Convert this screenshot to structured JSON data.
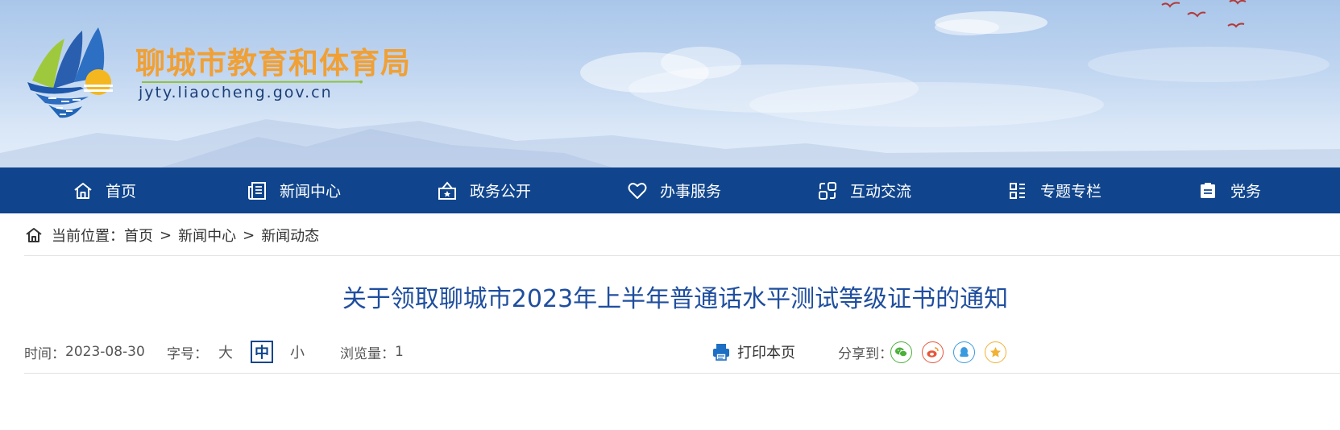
{
  "header": {
    "site_name": "聊城市教育和体育局",
    "site_domain": "jyty.liaocheng.gov.cn",
    "brand_orange": "#f0a035",
    "brand_blue": "#10458d"
  },
  "nav": {
    "items": [
      {
        "label": "首页",
        "icon": "home-icon"
      },
      {
        "label": "新闻中心",
        "icon": "newspaper-icon"
      },
      {
        "label": "政务公开",
        "icon": "government-icon"
      },
      {
        "label": "办事服务",
        "icon": "heart-icon"
      },
      {
        "label": "互动交流",
        "icon": "interaction-icon"
      },
      {
        "label": "专题专栏",
        "icon": "grid-icon"
      },
      {
        "label": "党务",
        "icon": "party-icon"
      }
    ]
  },
  "breadcrumb": {
    "prefix": "当前位置：",
    "items": [
      "首页",
      "新闻中心",
      "新闻动态"
    ],
    "separator": ">"
  },
  "article": {
    "title": "关于领取聊城市2023年上半年普通话水平测试等级证书的通知",
    "time_label": "时间：",
    "time_value": "2023-08-30",
    "font_size_label": "字号：",
    "font_sizes": [
      "大",
      "中",
      "小"
    ],
    "font_size_selected": "中",
    "views_label": "浏览量：",
    "views_value": "1",
    "print_label": "打印本页",
    "share_label": "分享到：",
    "share_targets": [
      "wechat-icon",
      "weibo-icon",
      "qq-icon",
      "qzone-icon"
    ]
  }
}
